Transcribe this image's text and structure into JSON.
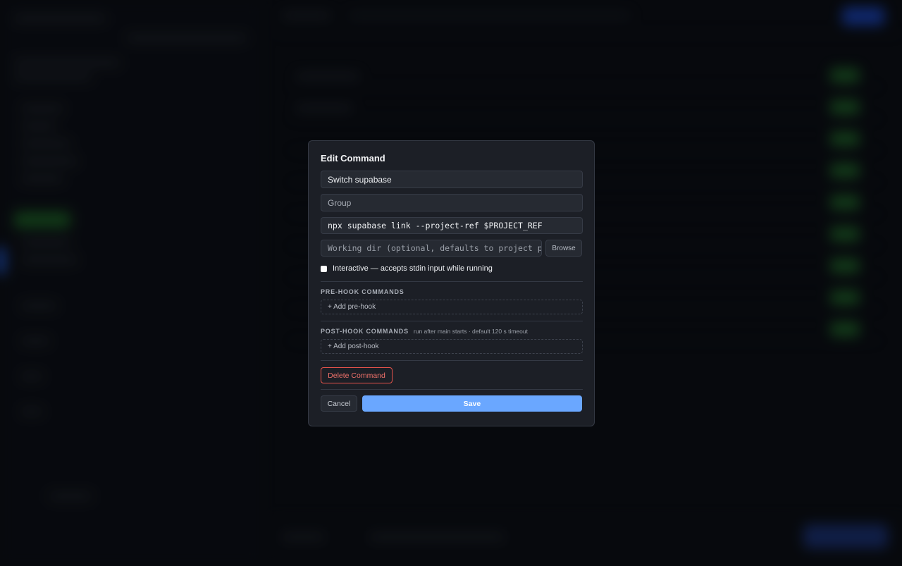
{
  "modal": {
    "title": "Edit Command",
    "name_value": "Switch supabase",
    "group_placeholder": "Group",
    "command_value": "npx supabase link --project-ref $PROJECT_REF",
    "working_dir_placeholder": "Working dir (optional, defaults to project path)",
    "browse_label": "Browse",
    "interactive_label": "Interactive — accepts stdin input while running",
    "interactive_checked": false,
    "pre_hook": {
      "title": "PRE-HOOK COMMANDS",
      "add_label": "+ Add pre-hook"
    },
    "post_hook": {
      "title": "POST-HOOK COMMANDS",
      "note": "run after main starts · default 120 s timeout",
      "add_label": "+ Add post-hook"
    },
    "delete_label": "Delete Command",
    "cancel_label": "Cancel",
    "save_label": "Save"
  },
  "colors": {
    "accent": "#6aa7ff",
    "danger": "#e5534b",
    "modal_bg": "#1c1f26"
  }
}
